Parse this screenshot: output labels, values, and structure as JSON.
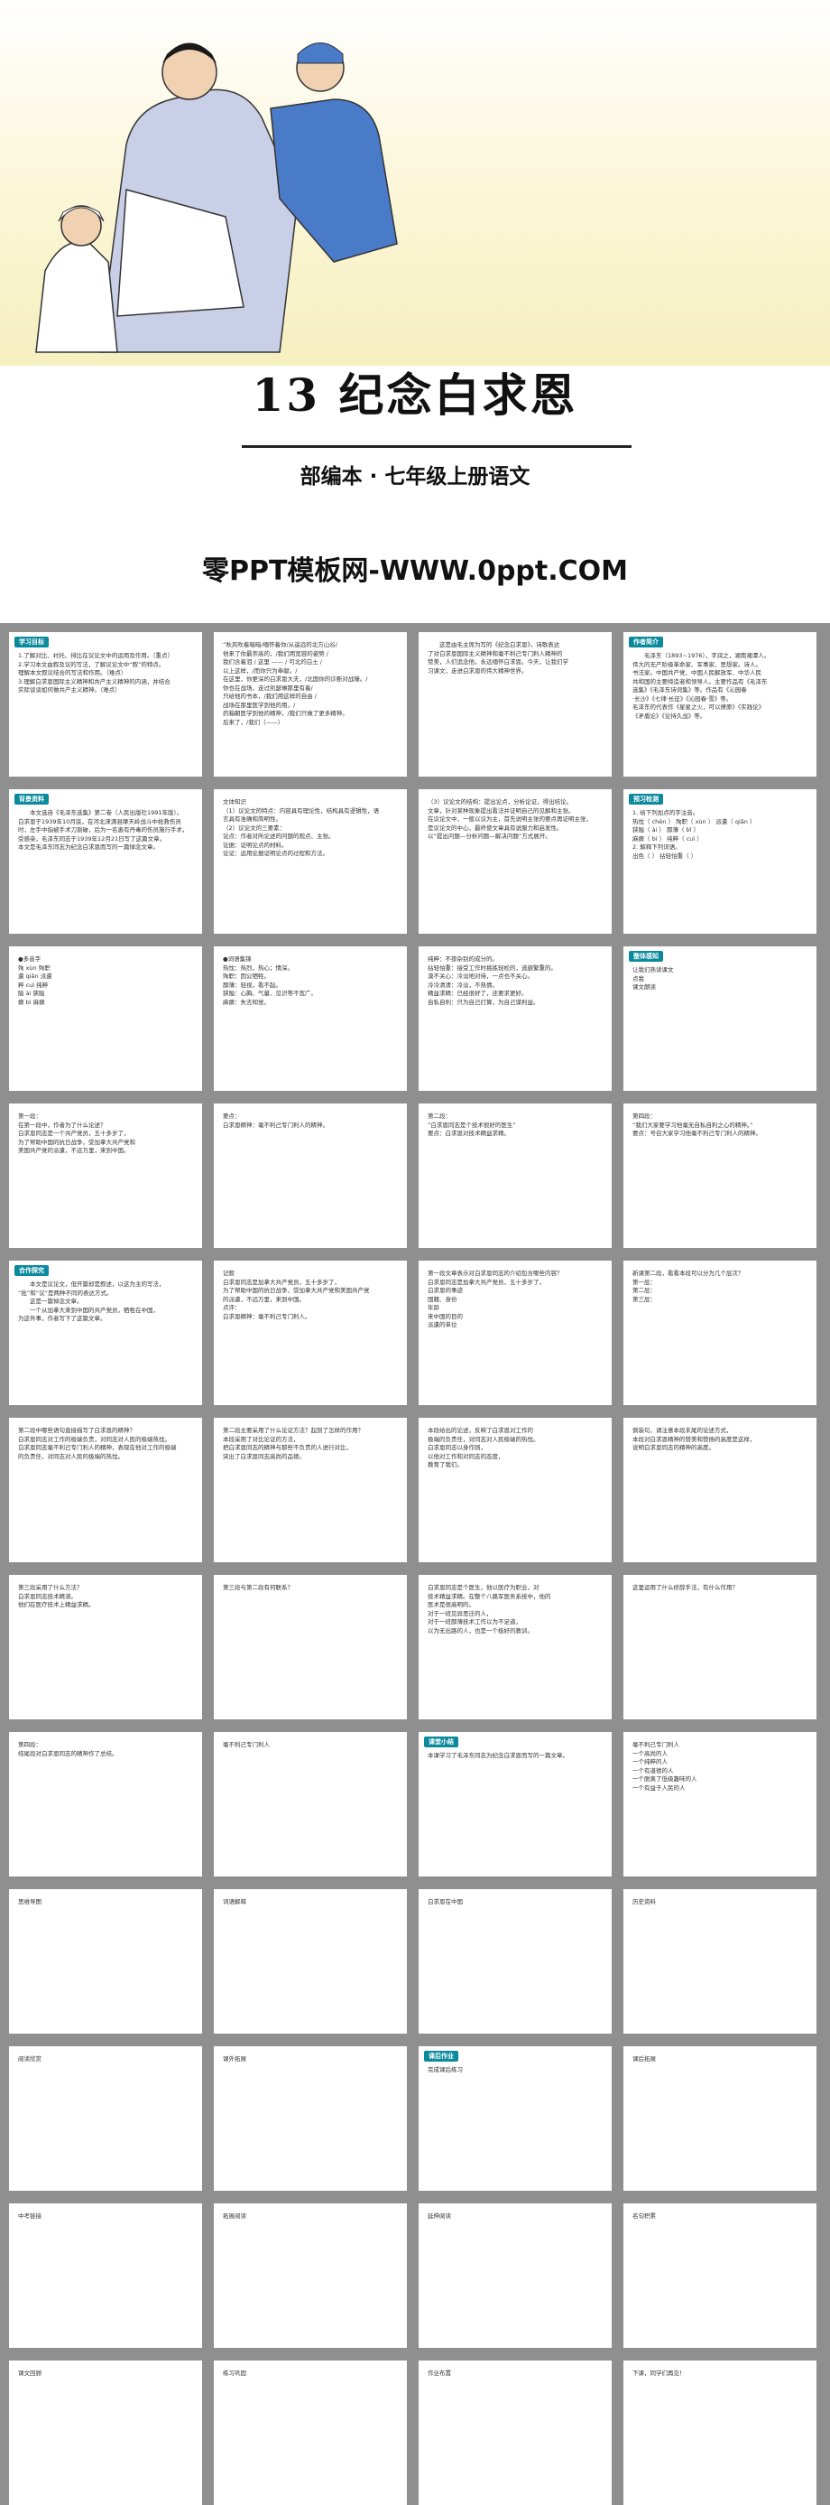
{
  "hero": {
    "title": "13  纪念白求恩",
    "subtitle": "部编本 · 七年级上册语文",
    "site": "零PPT模板网-WWW.0ppt.COM"
  },
  "slides": [
    {
      "tag": "学习目标",
      "lines": [
        "1.了解对比、衬托、排比在议论文中的运用及作用。（重点）",
        "2.学习本文由叙及议的写法，了解议论文中“叙”的特点。",
        "理解本文叙议结合的写法和作用。（难点）",
        "3.理解白求恩国际主义精神和共产主义精神的内涵，并结合",
        "实际谈谈如何做共产主义精神。（难点）"
      ]
    },
    {
      "tag": "",
      "lines": [
        "“秋风吹着暗暗/缅怀着你/从遥远的北方山谷/",
        "他来了你最崇高的，/我们用宽容的姿势 /",
        "我们含着泪 / 这里 —— / 可北的白土 /",
        "以上这样，/而你只为奉献。/",
        "在这里，你更深的白求恩大夫，/北国你的诊断对战壕。/",
        "你也在战场，走过凯瑟琳那里有着/",
        "只给他的书本，/我们用这样的自由 /",
        "战场在那里医学到他的用，/",
        "药箱朝医学到他的精神，/我们只做了更多精神。",
        "后来了，/我们（——）"
      ]
    },
    {
      "tag": "",
      "lines": [
        "　　这是由毛主席为写的《纪念白求恩》，诗歌表达",
        "了对白求恩国际主义精神和毫不利己专门利人精神的",
        "赞美，人们追念他，永远缅怀白求恩。今天，让我们学",
        "习课文，走进白求恩的伟大精神世界。"
      ]
    },
    {
      "tag": "作者简介",
      "lines": [
        "　　毛泽东（1893~1976），字润之，湖南湘潭人。",
        "伟大的无产阶级革命家、军事家、思想家。诗人。",
        "书法家。中国共产党、中国人民解放军、中华人民",
        "共和国的主要缔造者和领导人。主要作品有《毛泽东",
        "选集》《毛泽东诗词集》等。作品有《沁园春",
        "·长沙》《七律·长征》《沁园春·雪》等。",
        "毛泽东的代表作《星星之火，可以燎原》《实践论》",
        "《矛盾论》《论持久战》等。"
      ]
    },
    {
      "tag": "背景资料",
      "lines": [
        "　　本文选自《毛泽东选集》第二卷（人民出版社1991年版）。",
        "白求恩于1939年10月底，在河北涞源县摩天岭战斗中抢救伤员",
        "时，左手中指被手术刀割破，后为一名患有丹毒的伤员施行手术，",
        "受感染，毛泽东同志于1939年12月21日写了这篇文章。",
        "本文是毛泽东同志为纪念白求恩而写的一篇悼念文章。"
      ]
    },
    {
      "tag": "",
      "lines": [
        "文体知识",
        "（1）议论文的特点：内容具有理论性，结构具有逻辑性，语",
        "言具有准确和简明性。",
        "（2）议论文的三要素：",
        "论点：作者对所论述的问题的观点、主张。",
        "论据：证明论点的材料。",
        "论证：运用论据证明论点的过程和方法。"
      ]
    },
    {
      "tag": "",
      "lines": [
        "（3）议论文的结构：提出论点，分析论证，得出结论。",
        "文章，针对某种现象提出看法并证明自己的见解和主张。",
        "在议论文中，一般以议为主，首先说明主张的要点再证明主张，",
        "是议论文的中心，最终使文章具有说服力和启发性。",
        "以“提出问题—分析问题—解决问题”方式展开。"
      ]
    },
    {
      "tag": "预习检测",
      "lines": [
        "1. 给下列加点的字注音。",
        "热忱（ chén ）  殉职（ xùn ）  派遣（ qiǎn ）",
        "狭隘（ ài ）    鄙薄（ bǐ ）",
        "麻痹（ bì ）    纯粹（ cuì ）",
        "2. 解释下列词语。",
        "出色（ ）  拈轻怕重（ ）"
      ]
    },
    {
      "tag": "",
      "lines": [
        "●多音字",
        "殉  xùn 殉职",
        "遣  qiǎn 派遣",
        "粹  cuì 纯粹",
        "隘  ài 狭隘",
        "",
        "痹  bì  麻痹"
      ]
    },
    {
      "tag": "",
      "lines": [
        "●词语集锦",
        "热忱：热烈，热心；情深。",
        "殉职：因公牺牲。",
        "鄙薄：轻视，看不起。",
        "狭隘：心胸、气量、见识等不宽广。",
        "麻痹：失去知觉。"
      ]
    },
    {
      "tag": "",
      "lines": [
        "纯粹：不掺杂别的成分的。",
        "拈轻怕重：接受工作时挑拣轻松的，逃避繁重的。",
        "漠不关心：冷淡地对待，一点也不关心。",
        "冷冷清清：冷淡，不热情。",
        "精益求精：已经很好了，还要求更好。",
        "自私自利：只为自己打算，为自己谋利益。"
      ]
    },
    {
      "tag": "整体感知",
      "lines": [
        "让我们熟读课文",
        "点我",
        "课文朗读"
      ]
    },
    {
      "tag": "",
      "lines": [
        "第一段：",
        "在第一段中，作者为了什么论述？",
        "白求恩同志是一个共产党员，五十多岁了，",
        "为了帮助中国的抗日战争，受加拿大共产党和",
        "美国共产党的派遣，不远万里，来到中国。"
      ]
    },
    {
      "tag": "",
      "lines": [
        "要点：",
        "白求恩精神：毫不利己专门利人的精神。"
      ]
    },
    {
      "tag": "",
      "lines": [
        "第二段：",
        "“白求恩同志是个技术很好的医生”",
        "要点：白求恩对技术精益求精。"
      ]
    },
    {
      "tag": "",
      "lines": [
        "第四段：",
        "“我们大家要学习他毫无自私自利之心的精神。”",
        "要点：号召大家学习他毫不利己专门利人的精神。"
      ]
    },
    {
      "tag": "合作探究",
      "lines": [
        "　　本文是议论文，但开篇却是叙述，以这为主的写法，",
        "“批”和“议”是两种不同的表达方式。",
        "　　这是一篇悼念文章。",
        "　　一个从加拿大来到中国的共产党员，牺牲在中国，",
        "为这件事，作者写下了这篇文章。"
      ]
    },
    {
      "tag": "",
      "lines": [
        "记叙",
        "白求恩同志是加拿大共产党员，五十多岁了，",
        "为了帮助中国的抗日战争，受加拿大共产党和美国共产党",
        "的派遣，不远万里，来到中国。",
        "点评：",
        "白求恩精神：毫不利己专门利人。"
      ]
    },
    {
      "tag": "",
      "lines": [
        "第一段文章表示对白求恩同志的介绍包含哪些内容？",
        "",
        "白求恩同志是加拿大共产党员，五十多岁了，",
        "白求恩的事迹",
        "国籍、身份",
        "年龄",
        "来中国的目的",
        "派遣的单位"
      ]
    },
    {
      "tag": "",
      "lines": [
        "新课第二段，看看本段可以分为几个层次？",
        "第一层：",
        "第二层：",
        "第三层："
      ]
    },
    {
      "tag": "",
      "lines": [
        "第二段中哪些语句直接描写了白求恩的精神？",
        "白求恩同志对工作的极端负责，对同志对人民的极端热忱。",
        "白求恩同志毫不利己专门利人的精神，表现在他对工作的极端",
        "的负责任，对同志对人民的极端的热忱。"
      ]
    },
    {
      "tag": "",
      "lines": [
        "第二段主要采用了什么论证方法？起到了怎样的作用？",
        "本段采用了对比论证的方法，",
        "把白求恩同志的精神与那些不负责的人进行对比，",
        "突出了白求恩同志高尚的品德。"
      ]
    },
    {
      "tag": "",
      "lines": [
        "本段给出的论述，反映了白求恩对工作的",
        "极端的负责任，对同志对人民极端的热忱。",
        "白求恩同志以身作则，",
        "以他对工作和对同志的态度，",
        "教育了我们。"
      ]
    },
    {
      "tag": "",
      "lines": [
        "倒装句，请注意本段末尾的论述方式，",
        "本段对白求恩精神的赞美和赞扬的高度是这样，",
        "说明白求恩同志的精神的高度。"
      ]
    },
    {
      "tag": "",
      "lines": [
        "第三段采用了什么方法？",
        "白求恩同志技术精湛。",
        "他们在医疗技术上精益求精。"
      ]
    },
    {
      "tag": "",
      "lines": [
        "第三段与第二段有何联系？"
      ]
    },
    {
      "tag": "",
      "lines": [
        "白求恩同志是个医生，他以医疗为职业，对",
        "技术精益求精。在整个八路军医务系统中，他的",
        "医术是很高明的。",
        "对于一班见异思迁的人，",
        "对于一班鄙薄技术工作以为不足道，",
        "以为无出路的人，也是一个极好的教训。"
      ]
    },
    {
      "tag": "",
      "lines": [
        "这里运用了什么修辞手法，有什么作用？"
      ]
    },
    {
      "tag": "",
      "lines": [
        "第四段：",
        "结尾段对白求恩同志的精神作了总结。"
      ]
    },
    {
      "tag": "",
      "lines": [
        "毫不利己专门利人"
      ]
    },
    {
      "tag": "课堂小结",
      "lines": [
        "本课学习了毛泽东同志为纪念白求恩而写的一篇文章。"
      ]
    },
    {
      "tag": "",
      "lines": [
        "毫不利己专门利人",
        "一个高尚的人",
        "一个纯粹的人",
        "一个有道德的人",
        "一个脱离了低级趣味的人",
        "一个有益于人民的人"
      ]
    },
    {
      "tag": "",
      "lines": [
        "思维导图"
      ]
    },
    {
      "tag": "",
      "lines": [
        "词语解释"
      ]
    },
    {
      "tag": "",
      "lines": [
        "白求恩在中国"
      ]
    },
    {
      "tag": "",
      "lines": [
        "历史资料"
      ]
    },
    {
      "tag": "",
      "lines": [
        "阅读欣赏"
      ]
    },
    {
      "tag": "",
      "lines": [
        "课外拓展"
      ]
    },
    {
      "tag": "课后作业",
      "lines": [
        "完成课后练习"
      ]
    },
    {
      "tag": "",
      "lines": [
        "课后拓展"
      ]
    },
    {
      "tag": "",
      "lines": [
        "中考链接"
      ]
    },
    {
      "tag": "",
      "lines": [
        "拓展阅读"
      ]
    },
    {
      "tag": "",
      "lines": [
        "延伸阅读"
      ]
    },
    {
      "tag": "",
      "lines": [
        "名句积累"
      ]
    },
    {
      "tag": "",
      "lines": [
        "课文回顾"
      ]
    },
    {
      "tag": "",
      "lines": [
        "练习巩固"
      ]
    },
    {
      "tag": "",
      "lines": [
        "作业布置"
      ]
    },
    {
      "tag": "",
      "lines": [
        "下课，同学们再见！"
      ]
    }
  ]
}
